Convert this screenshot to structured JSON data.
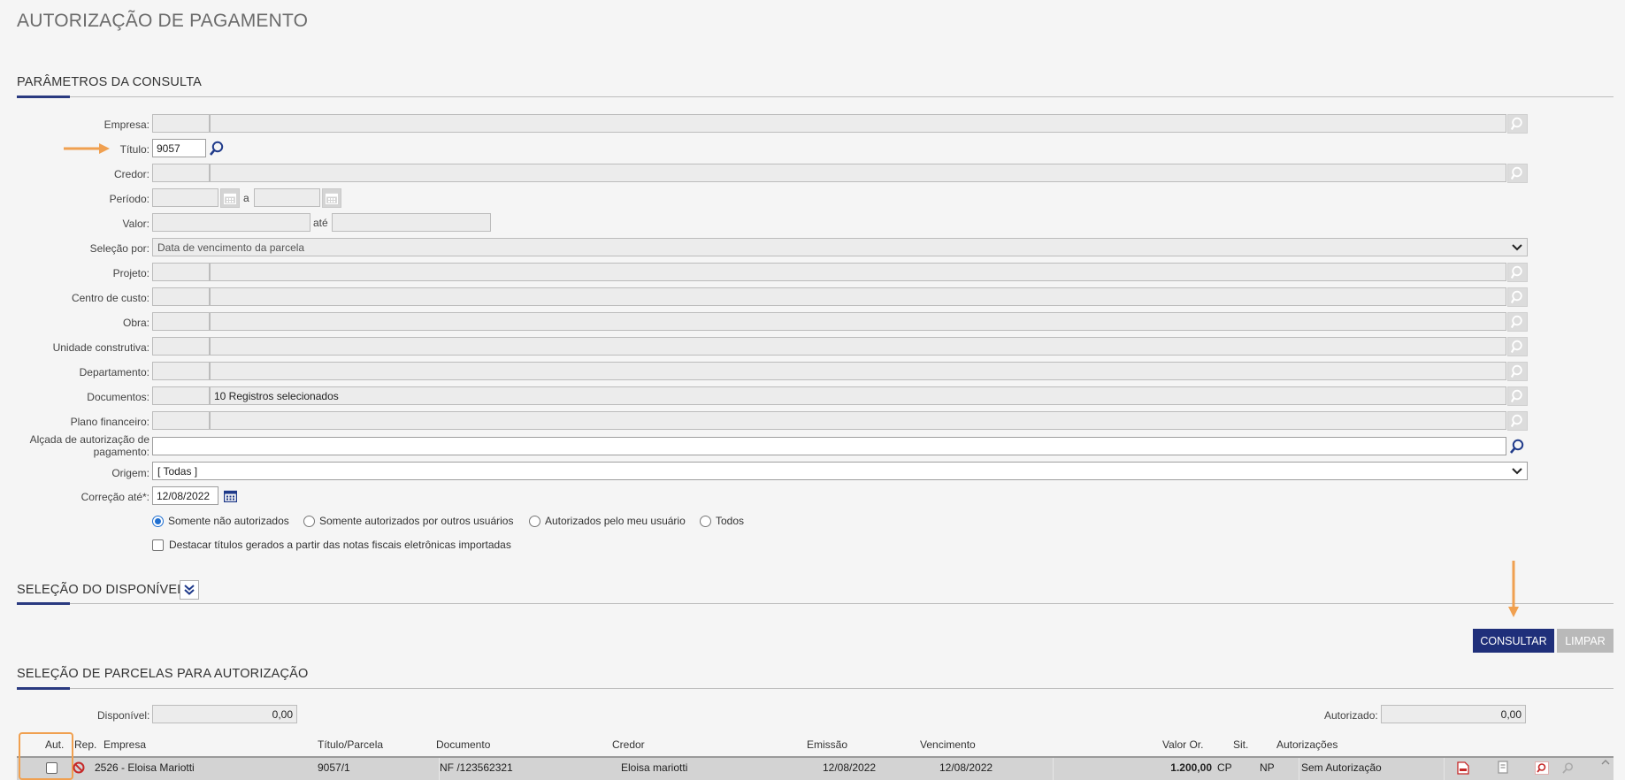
{
  "page_title": "AUTORIZAÇÃO DE PAGAMENTO",
  "sections": {
    "params": "PARÂMETROS DA CONSULTA",
    "disponivel": "SELEÇÃO DO DISPONÍVEL",
    "parcelas": "SELEÇÃO DE PARCELAS PARA AUTORIZAÇÃO"
  },
  "form": {
    "empresa_label": "Empresa:",
    "titulo_label": "Título:",
    "titulo_value": "9057",
    "credor_label": "Credor:",
    "periodo_label": "Período:",
    "periodo_sep": "a",
    "valor_label": "Valor:",
    "valor_sep": "até",
    "selecao_label": "Seleção por:",
    "selecao_value": "Data de vencimento da parcela",
    "projeto_label": "Projeto:",
    "centro_label": "Centro de custo:",
    "obra_label": "Obra:",
    "unidade_label": "Unidade construtiva:",
    "departamento_label": "Departamento:",
    "documentos_label": "Documentos:",
    "documentos_value": "10 Registros selecionados",
    "plano_label": "Plano financeiro:",
    "alcada_label_1": "Alçada de autorização de",
    "alcada_label_2": "pagamento:",
    "origem_label": "Origem:",
    "origem_value": "[ Todas ]",
    "correcao_label": "Correção até*:",
    "correcao_value": "12/08/2022"
  },
  "radios": [
    {
      "label": "Somente não autorizados",
      "checked": true
    },
    {
      "label": "Somente autorizados por outros usuários",
      "checked": false
    },
    {
      "label": "Autorizados pelo meu usuário",
      "checked": false
    },
    {
      "label": "Todos",
      "checked": false
    }
  ],
  "checkbox_label": "Destacar títulos gerados a partir das notas fiscais eletrônicas importadas",
  "buttons": {
    "consultar": "CONSULTAR",
    "limpar": "LIMPAR"
  },
  "totals": {
    "disponivel_label": "Disponível:",
    "disponivel_value": "0,00",
    "autorizado_label": "Autorizado:",
    "autorizado_value": "0,00"
  },
  "table": {
    "headers": {
      "aut": "Aut.",
      "rep": "Rep.",
      "empresa": "Empresa",
      "titulo": "Título/Parcela",
      "documento": "Documento",
      "credor": "Credor",
      "emissao": "Emissão",
      "vencimento": "Vencimento",
      "valor": "Valor Or.",
      "sit": "Sit.",
      "autorizacoes": "Autorizações"
    },
    "rows": [
      {
        "empresa": "2526 - Eloisa Mariotti",
        "titulo": "9057/1",
        "documento": "NF /123562321",
        "credor": "Eloisa mariotti",
        "emissao": "12/08/2022",
        "vencimento": "12/08/2022",
        "valor": "1.200,00",
        "sit1": "CP",
        "sit2": "NP",
        "autorizacoes": "Sem Autorização"
      }
    ]
  },
  "colors": {
    "primary": "#1f2f7a",
    "accent_orange": "#f0a050",
    "blue_icon": "#1f3a8a",
    "red_icon": "#c62828"
  }
}
